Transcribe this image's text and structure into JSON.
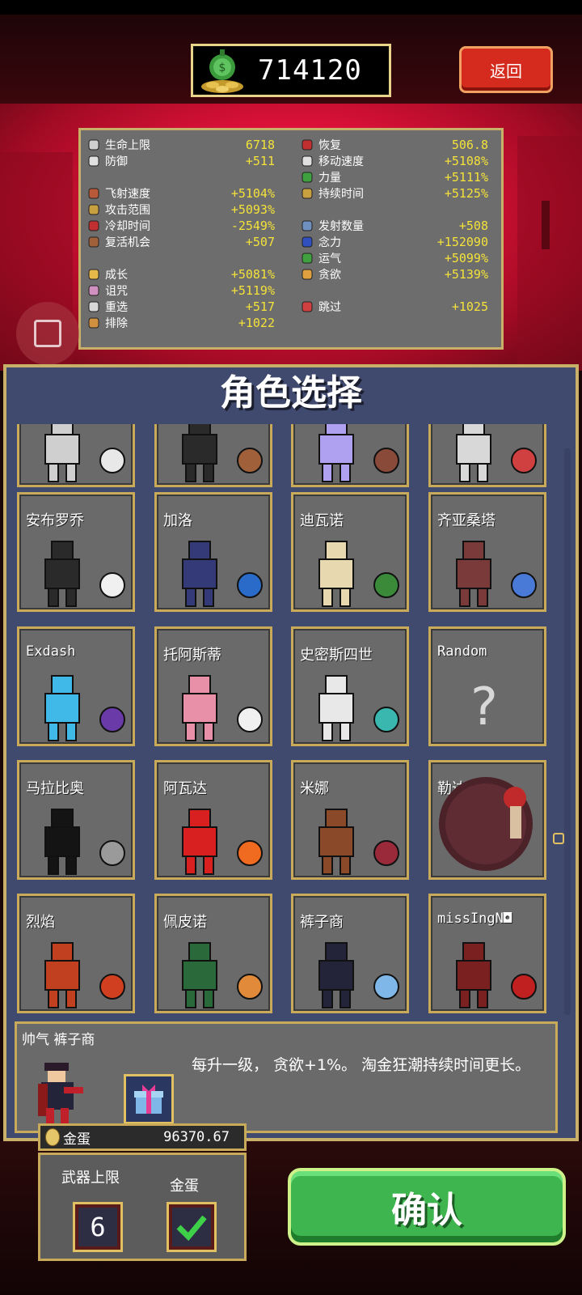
{
  "header": {
    "coins": "714120",
    "back_label": "返回"
  },
  "stats": {
    "left": [
      {
        "name": "生命上限",
        "value": "6718",
        "icon": "heart-icon"
      },
      {
        "name": "防御",
        "value": "+511",
        "icon": "shield-icon"
      },
      {
        "name": "飞射速度",
        "value": "+5104%",
        "icon": "projectile-speed-icon"
      },
      {
        "name": "攻击范围",
        "value": "+5093%",
        "icon": "area-icon"
      },
      {
        "name": "冷却时间",
        "value": "-2549%",
        "icon": "cooldown-icon"
      },
      {
        "name": "复活机会",
        "value": "+507",
        "icon": "revival-icon"
      },
      {
        "name": "成长",
        "value": "+5081%",
        "icon": "growth-icon"
      },
      {
        "name": "诅咒",
        "value": "+5119%",
        "icon": "curse-skull-icon"
      },
      {
        "name": "重选",
        "value": "+517",
        "icon": "reroll-icon"
      },
      {
        "name": "排除",
        "value": "+1022",
        "icon": "banish-icon"
      }
    ],
    "right": [
      {
        "name": "恢复",
        "value": "506.8",
        "icon": "recovery-heart-icon"
      },
      {
        "name": "移动速度",
        "value": "+5108%",
        "icon": "wing-icon"
      },
      {
        "name": "力量",
        "value": "+5111%",
        "icon": "might-leaf-icon"
      },
      {
        "name": "持续时间",
        "value": "+5125%",
        "icon": "duration-icon"
      },
      {
        "name": "发射数量",
        "value": "+508",
        "icon": "amount-icon"
      },
      {
        "name": "念力",
        "value": "+152090",
        "icon": "magnet-orb-icon"
      },
      {
        "name": "运气",
        "value": "+5099%",
        "icon": "luck-clover-icon"
      },
      {
        "name": "贪欲",
        "value": "+5139%",
        "icon": "greed-icon"
      },
      {
        "name": "跳过",
        "value": "+1025",
        "icon": "skip-icon"
      }
    ]
  },
  "panel": {
    "title": "角色选择"
  },
  "characters": [
    {
      "name": "",
      "weapon_icon": "bone-icon"
    },
    {
      "name": "",
      "weapon_icon": "cherry-bomb-icon"
    },
    {
      "name": "",
      "weapon_icon": "wheel-icon"
    },
    {
      "name": "",
      "weapon_icon": "flower-icon"
    },
    {
      "name": "安布罗乔",
      "weapon_icon": "egg-icon"
    },
    {
      "name": "加洛",
      "weapon_icon": "blue-wand-icon"
    },
    {
      "name": "迪瓦诺",
      "weapon_icon": "leaf-icon"
    },
    {
      "name": "齐亚桑塔",
      "weapon_icon": "blue-ring-icon"
    },
    {
      "name": "Exdash",
      "weapon_icon": "purple-bird-icon"
    },
    {
      "name": "托阿斯蒂",
      "weapon_icon": "white-dove-icon"
    },
    {
      "name": "史密斯四世",
      "weapon_icon": "teal-bird-icon"
    },
    {
      "name": "Random",
      "weapon_icon": "question-mark-icon"
    },
    {
      "name": "马拉比奥",
      "weapon_icon": "knives-icon"
    },
    {
      "name": "阿瓦达",
      "weapon_icon": "fireball-icon"
    },
    {
      "name": "米娜",
      "weapon_icon": "red-skull-icon"
    },
    {
      "name": "勒达",
      "weapon_icon": "none"
    },
    {
      "name": "烈焰",
      "weapon_icon": "phoenix-icon"
    },
    {
      "name": "佩皮诺",
      "weapon_icon": "orange-ball-icon"
    },
    {
      "name": "裤子商",
      "weapon_icon": "gift-box-icon"
    },
    {
      "name": "missIngN◘",
      "weapon_icon": "glitch-icon"
    }
  ],
  "selected": {
    "title": "帅气 裤子商",
    "description": "每升一级， 贪欲+1%。 淘金狂潮持续时间更长。",
    "item_icon": "gift-box-icon"
  },
  "gold_egg": {
    "label": "金蛋",
    "value": "96370.67"
  },
  "options": {
    "weapon_limit_label": "武器上限",
    "weapon_limit_value": "6",
    "gold_egg_label": "金蛋",
    "gold_egg_checked": true
  },
  "confirm_label": "确认",
  "colors": {
    "stat_value": "#f4e23a",
    "panel_bg": "#404a6e",
    "card_border": "#c9a95a",
    "confirm_green": "#3fb54f",
    "back_red": "#d52b1e"
  }
}
